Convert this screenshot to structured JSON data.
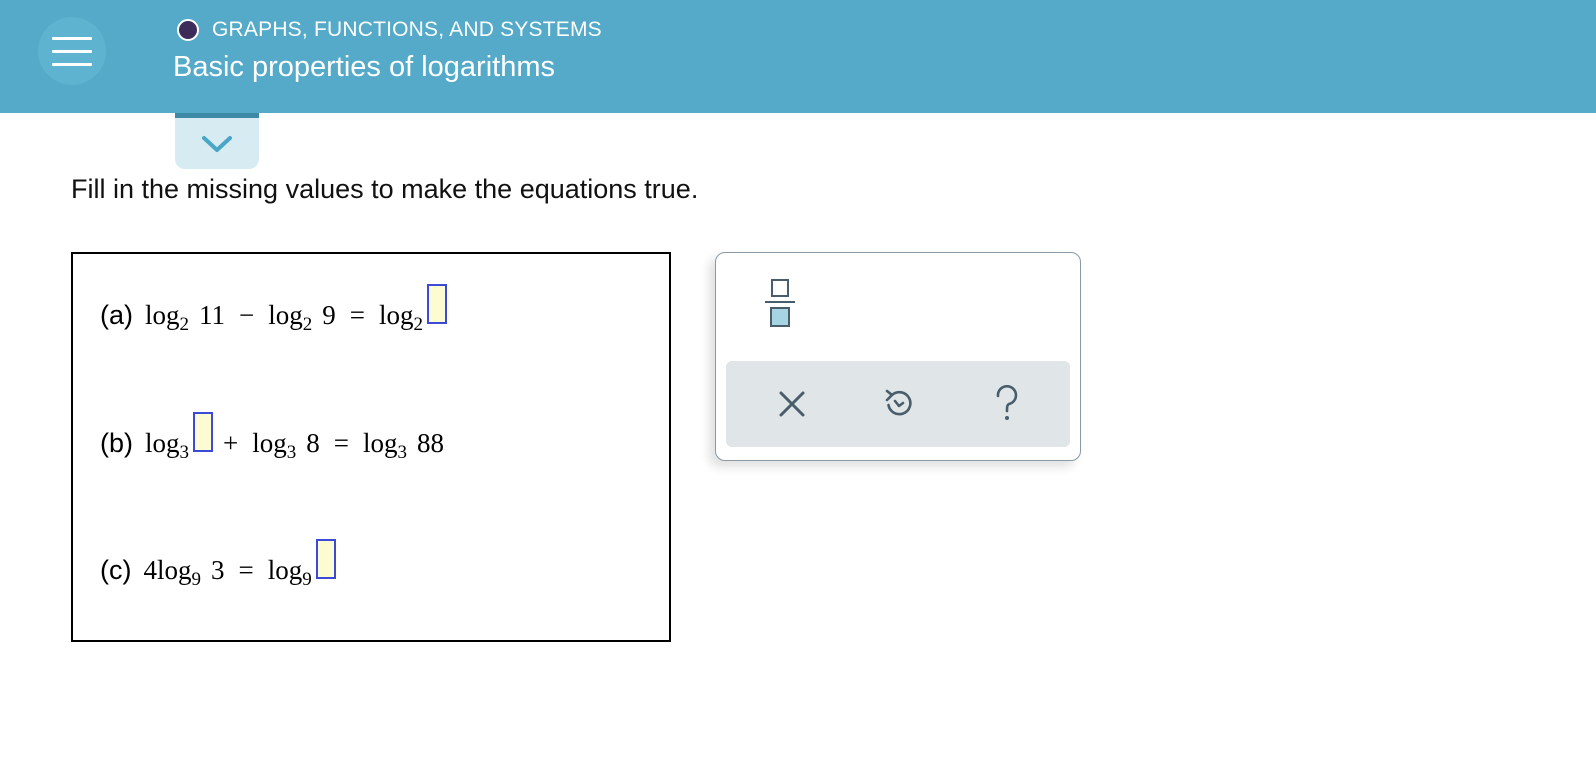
{
  "header": {
    "category": "GRAPHS, FUNCTIONS, AND SYSTEMS",
    "title": "Basic properties of logarithms",
    "menu_icon": "hamburger-menu-icon",
    "collapse_icon": "chevron-down-icon"
  },
  "prompt": "Fill in the missing values to make the equations true.",
  "problems": {
    "a": {
      "label": "(a)",
      "log": "log",
      "base": "2",
      "arg1": "11",
      "op": "−",
      "arg2": "9",
      "eq": "=",
      "answer": ""
    },
    "b": {
      "label": "(b)",
      "log": "log",
      "base": "3",
      "answer": "",
      "op": "+",
      "arg2": "8",
      "eq": "=",
      "arg3": "88"
    },
    "c": {
      "label": "(c)",
      "coef": "4",
      "log": "log",
      "base": "9",
      "arg1": "3",
      "eq": "=",
      "answer": ""
    }
  },
  "keypad": {
    "fraction_icon": "fraction-icon",
    "clear_icon": "close-icon",
    "undo_icon": "undo-icon",
    "help_icon": "question-mark-icon"
  },
  "colors": {
    "header_bg": "#54aac8",
    "category_dot": "#3d2b5a",
    "answer_box_bg": "#fdfbd2",
    "answer_box_border": "#3b4bd8",
    "keypad_icon": "#4a5d6a"
  }
}
